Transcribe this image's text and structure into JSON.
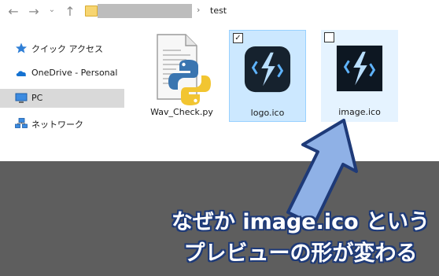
{
  "address_bar": {
    "back_glyph": "←",
    "forward_glyph": "→",
    "recent_glyph": "⌄",
    "up_glyph": "↑",
    "separator": "›",
    "current_folder": "test"
  },
  "sidebar": {
    "items": [
      {
        "label": "クイック アクセス",
        "icon": "star-icon"
      },
      {
        "label": "OneDrive - Personal",
        "icon": "cloud-icon"
      },
      {
        "label": "PC",
        "icon": "computer-icon",
        "selected": true
      },
      {
        "label": "ネットワーク",
        "icon": "network-icon"
      }
    ]
  },
  "files": [
    {
      "name": "Wav_Check.py",
      "icon": "python-file-icon",
      "selected": false
    },
    {
      "name": "logo.ico",
      "icon": "lightning-icon",
      "selected": true,
      "checked": true
    },
    {
      "name": "image.ico",
      "icon": "lightning-icon",
      "selected": false,
      "checked": false
    }
  ],
  "annotation": {
    "line1": "なぜか image.ico という",
    "line2": "プレビューの形が変わる",
    "text_color": "#ffffff",
    "outline_color": "#1e3a78",
    "arrow_color": "#8fb1e6"
  },
  "colors": {
    "selection_fill": "#cce8ff",
    "selection_border": "#99d1ff",
    "hover_fill": "#e5f3ff",
    "overlay": "#5e5e5e"
  }
}
